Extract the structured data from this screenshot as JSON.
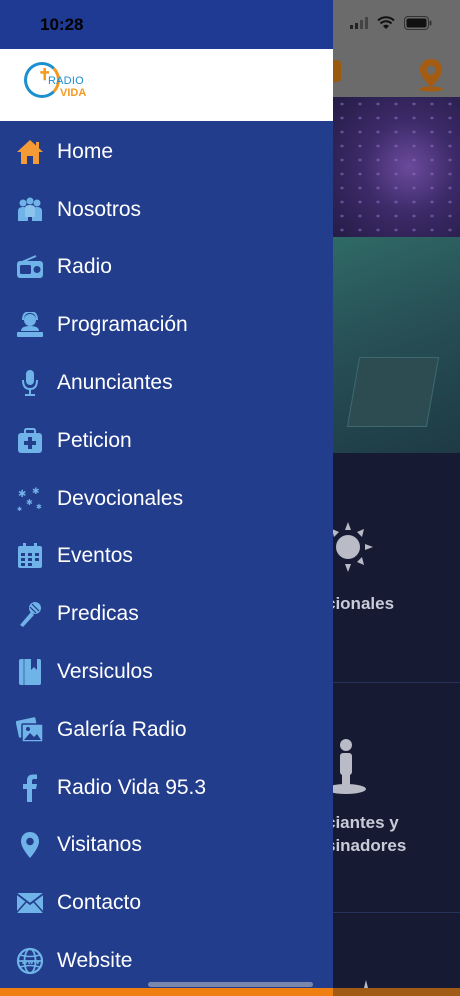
{
  "status_bar": {
    "time": "10:28",
    "icons": [
      "signal-icon",
      "wifi-icon",
      "battery-icon"
    ]
  },
  "colors": {
    "drawer_bg": "#233d8d",
    "icon_accent": "#6fb3e8",
    "home_icon": "#f49b35",
    "bottom_bar": "#f07f12"
  },
  "drawer": {
    "logo_text_top": "RADIO",
    "logo_text_bottom": "VIDA",
    "items": [
      {
        "label": "Home",
        "icon": "home-icon"
      },
      {
        "label": "Nosotros",
        "icon": "users-icon"
      },
      {
        "label": "Radio",
        "icon": "radio-icon"
      },
      {
        "label": "Programación",
        "icon": "dj-icon"
      },
      {
        "label": "Anunciantes",
        "icon": "microphone-icon"
      },
      {
        "label": "Peticion",
        "icon": "first-aid-icon"
      },
      {
        "label": "Devocionales",
        "icon": "sparkles-icon"
      },
      {
        "label": "Eventos",
        "icon": "calendar-icon"
      },
      {
        "label": "Predicas",
        "icon": "mic-hand-icon"
      },
      {
        "label": "Versiculos",
        "icon": "book-icon"
      },
      {
        "label": "Galería Radio",
        "icon": "gallery-icon"
      },
      {
        "label": "Radio Vida 95.3",
        "icon": "facebook-icon"
      },
      {
        "label": "Visitanos",
        "icon": "location-pin-icon"
      },
      {
        "label": "Contacto",
        "icon": "envelope-icon"
      },
      {
        "label": "Website",
        "icon": "globe-icon"
      }
    ]
  },
  "background": {
    "tile_devocionales": "cionales",
    "tile_anunciantes_line1": "ciantes y",
    "tile_anunciantes_line2": "sinadores"
  }
}
